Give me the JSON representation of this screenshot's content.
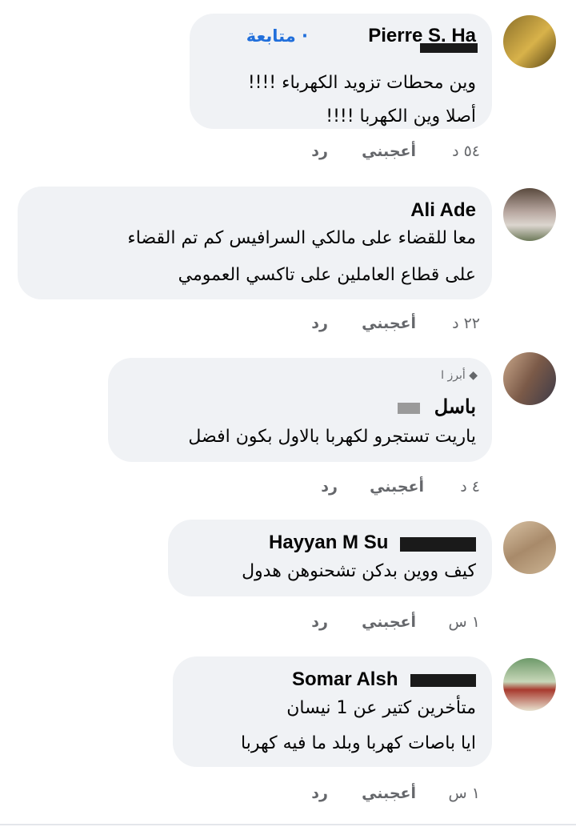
{
  "comments": [
    {
      "author": "Pierre S. Ha",
      "follow": "متابعة",
      "lines": [
        "وين محطات تزويد الكهرباء !!!!",
        "أصلا وين الكهربا !!!!"
      ],
      "time": "٥٤ د",
      "like": "أعجبني",
      "reply": "رد"
    },
    {
      "author": "Ali Ade",
      "lines": [
        "معا للقضاء على مالكي السرافيس كم تم القضاء",
        "على قطاع العاملين على تاكسي العمومي"
      ],
      "time": "٢٢ د",
      "like": "أعجبني",
      "reply": "رد"
    },
    {
      "badge": "أبرز ا",
      "author": "باسل",
      "lines": [
        "ياريت تستجرو لكهربا بالاول بكون افضل"
      ],
      "time": "٤ د",
      "like": "أعجبني",
      "reply": "رد"
    },
    {
      "author": "Hayyan M Su",
      "lines": [
        "كيف ووين بدكن تشحنوهن هدول"
      ],
      "time": "١ س",
      "like": "أعجبني",
      "reply": "رد"
    },
    {
      "author": "Somar Alsh",
      "lines": [
        "متأخرين كتير عن 1 نيسان",
        "ايا باصات كهربا وبلد ما فيه كهربا"
      ],
      "time": "١ س",
      "like": "أعجبني",
      "reply": "رد"
    }
  ]
}
